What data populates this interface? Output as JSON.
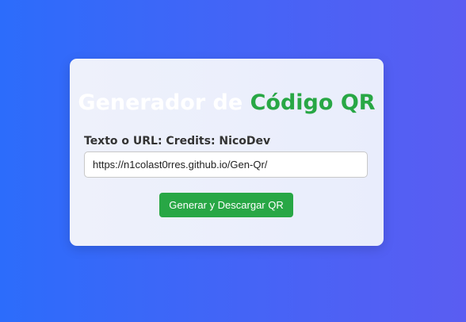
{
  "title": {
    "part1": "Generador de ",
    "part2": "Código QR"
  },
  "form": {
    "label": "Texto o URL: Credits: NicoDev",
    "input_value": "https://n1colast0rres.github.io/Gen-Qr/",
    "button_label": "Generar y Descargar QR"
  },
  "colors": {
    "accent": "#28a745"
  }
}
